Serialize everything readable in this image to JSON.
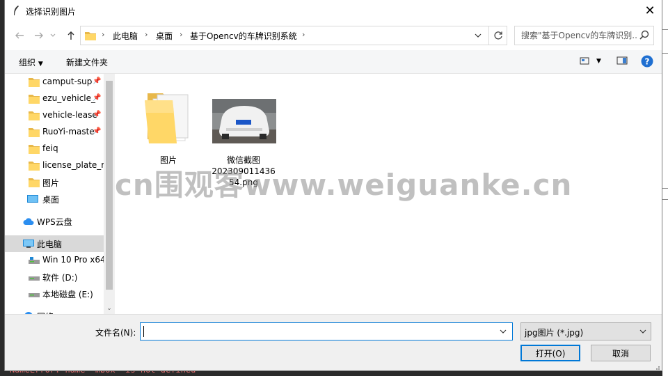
{
  "background": {
    "error_text": "NameError: name 'mbox' is not defined"
  },
  "dialog": {
    "title": "选择识别图片",
    "close_glyph": "✕"
  },
  "nav": {
    "back_icon": "arrow-left-icon",
    "forward_icon": "arrow-right-icon",
    "up_icon": "arrow-up-icon",
    "breadcrumbs": [
      "此电脑",
      "桌面",
      "基于Opencv的车牌识别系统"
    ],
    "search_placeholder": "搜索\"基于Opencv的车牌识别..."
  },
  "toolbar": {
    "organize_label": "组织",
    "new_folder_label": "新建文件夹"
  },
  "sidebar": {
    "items": [
      {
        "label": "camput-sup",
        "icon": "folder-icon",
        "pinned": true
      },
      {
        "label": "ezu_vehicle_",
        "icon": "folder-icon",
        "pinned": true
      },
      {
        "label": "vehicle-lease",
        "icon": "folder-icon",
        "pinned": true
      },
      {
        "label": "RuoYi-maste",
        "icon": "folder-icon",
        "pinned": true
      },
      {
        "label": "feiq",
        "icon": "folder-icon",
        "pinned": false
      },
      {
        "label": "license_plate_re",
        "icon": "folder-icon",
        "pinned": false
      },
      {
        "label": "图片",
        "icon": "folder-icon",
        "pinned": false
      },
      {
        "label": "桌面",
        "icon": "desktop-icon",
        "pinned": false
      },
      {
        "label": "WPS云盘",
        "icon": "cloud-icon",
        "pinned": false
      },
      {
        "label": "此电脑",
        "icon": "computer-icon",
        "pinned": false,
        "selected": true
      },
      {
        "label": "Win 10 Pro x64",
        "icon": "drive-icon",
        "pinned": false
      },
      {
        "label": "软件 (D:)",
        "icon": "drive-icon",
        "pinned": false
      },
      {
        "label": "本地磁盘 (E:)",
        "icon": "drive-icon",
        "pinned": false
      },
      {
        "label": "网络",
        "icon": "network-icon",
        "pinned": false
      }
    ]
  },
  "files": [
    {
      "label": "图片",
      "type": "folder"
    },
    {
      "label": "微信截图_20230901143654.png",
      "label_visible": "微信截图\n202309011436\n54.png",
      "type": "image"
    }
  ],
  "bottom": {
    "filename_label": "文件名(N):",
    "filename_value": "",
    "filetype_value": "jpg图片 (*.jpg)",
    "open_label": "打开(O)",
    "cancel_label": "取消"
  },
  "watermark": "cn围观客www.weiguanke.cn",
  "colors": {
    "accent": "#0078d7",
    "folder": "#ffd767",
    "selection": "#d9d9d9",
    "help": "#1f6fd1"
  }
}
